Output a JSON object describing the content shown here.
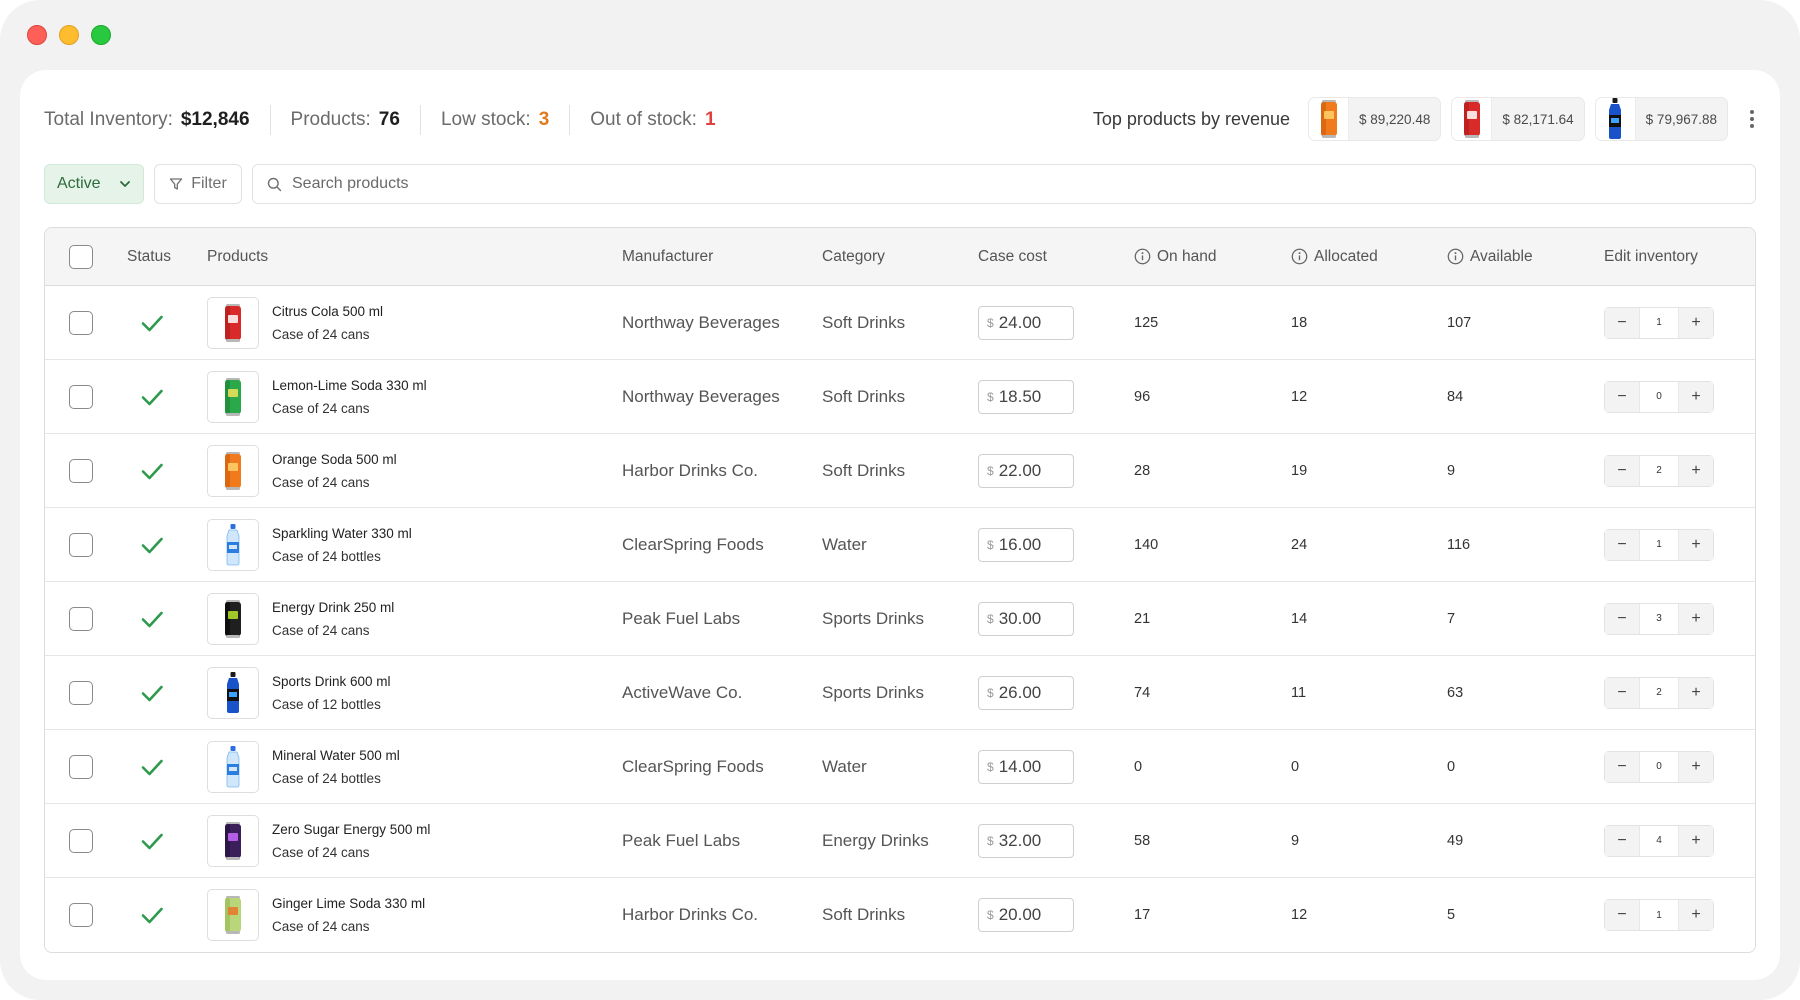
{
  "stats": {
    "total_inventory_label": "Total Inventory:",
    "total_inventory_value": "$12,846",
    "products_label": "Products:",
    "products_value": "76",
    "low_stock_label": "Low stock:",
    "low_stock_value": "3",
    "out_of_stock_label": "Out of stock:",
    "out_of_stock_value": "1"
  },
  "top_products": {
    "label": "Top products by revenue",
    "items": [
      {
        "value": "$ 89,220.48",
        "icon": "orange-can-icon"
      },
      {
        "value": "$ 82,171.64",
        "icon": "red-can-icon"
      },
      {
        "value": "$ 79,967.88",
        "icon": "blue-bottle-icon"
      }
    ]
  },
  "filters": {
    "status_label": "Active",
    "filter_label": "Filter",
    "search_placeholder": "Search products"
  },
  "table": {
    "headers": {
      "status": "Status",
      "products": "Products",
      "manufacturer": "Manufacturer",
      "category": "Category",
      "case_cost": "Case cost",
      "on_hand": "On hand",
      "allocated": "Allocated",
      "available": "Available",
      "edit_inventory": "Edit inventory"
    },
    "currency_symbol": "$",
    "rows": [
      {
        "name": "Citrus Cola 500 ml",
        "pack": "Case of 24 cans",
        "manufacturer": "Northway Beverages",
        "category": "Soft Drinks",
        "cost": "24.00",
        "on_hand": "125",
        "allocated": "18",
        "available": "107",
        "edit": "1",
        "icon": "red-can-icon"
      },
      {
        "name": "Lemon-Lime Soda 330 ml",
        "pack": "Case of 24 cans",
        "manufacturer": "Northway Beverages",
        "category": "Soft Drinks",
        "cost": "18.50",
        "on_hand": "96",
        "allocated": "12",
        "available": "84",
        "edit": "0",
        "icon": "green-can-icon"
      },
      {
        "name": "Orange Soda 500 ml",
        "pack": "Case of 24 cans",
        "manufacturer": "Harbor Drinks Co.",
        "category": "Soft Drinks",
        "cost": "22.00",
        "on_hand": "28",
        "allocated": "19",
        "available": "9",
        "edit": "2",
        "icon": "orange-can-icon"
      },
      {
        "name": "Sparkling Water 330 ml",
        "pack": "Case of 24 bottles",
        "manufacturer": "ClearSpring Foods",
        "category": "Water",
        "cost": "16.00",
        "on_hand": "140",
        "allocated": "24",
        "available": "116",
        "edit": "1",
        "icon": "water-bottle-icon"
      },
      {
        "name": "Energy Drink 250 ml",
        "pack": "Case of 24 cans",
        "manufacturer": "Peak Fuel Labs",
        "category": "Sports Drinks",
        "cost": "30.00",
        "on_hand": "21",
        "allocated": "14",
        "available": "7",
        "edit": "3",
        "icon": "black-can-icon"
      },
      {
        "name": "Sports Drink 600 ml",
        "pack": "Case of 12 bottles",
        "manufacturer": "ActiveWave Co.",
        "category": "Sports Drinks",
        "cost": "26.00",
        "on_hand": "74",
        "allocated": "11",
        "available": "63",
        "edit": "2",
        "icon": "blue-bottle-icon"
      },
      {
        "name": "Mineral Water 500 ml",
        "pack": "Case of 24 bottles",
        "manufacturer": "ClearSpring Foods",
        "category": "Water",
        "cost": "14.00",
        "on_hand": "0",
        "allocated": "0",
        "available": "0",
        "edit": "0",
        "icon": "water-bottle-icon"
      },
      {
        "name": "Zero Sugar Energy 500 ml",
        "pack": "Case of 24 cans",
        "manufacturer": "Peak Fuel Labs",
        "category": "Energy Drinks",
        "cost": "32.00",
        "on_hand": "58",
        "allocated": "9",
        "available": "49",
        "edit": "4",
        "icon": "purple-can-icon"
      },
      {
        "name": "Ginger Lime Soda 330 ml",
        "pack": "Case of 24 cans",
        "manufacturer": "Harbor Drinks Co.",
        "category": "Soft Drinks",
        "cost": "20.00",
        "on_hand": "17",
        "allocated": "12",
        "available": "5",
        "edit": "1",
        "icon": "lime-can-icon"
      }
    ]
  },
  "colors": {
    "accent_green": "#2f9a4d",
    "low_stock_orange": "#e07a1f",
    "out_of_stock_red": "#e04040"
  }
}
